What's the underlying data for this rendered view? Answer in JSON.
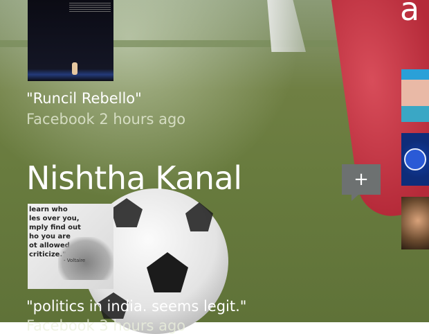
{
  "feed": {
    "item1": {
      "caption": "\"Runcil Rebello\"",
      "meta": "Facebook 2 hours ago"
    },
    "item2": {
      "name": "Nishtha Kanal",
      "quote_image_text": "learn who\nles over you,\nmply find out\nho you are\not allowed\ncriticize.\"",
      "quote_attrib": "- Voltaire",
      "caption": "\"politics in india. seems legit.\"",
      "meta": "Facebook 3 hours ago"
    }
  },
  "actions": {
    "comment_icon": "plus-comment-icon",
    "comment_label": "+"
  },
  "side_panel": {
    "header_letter": "a"
  }
}
